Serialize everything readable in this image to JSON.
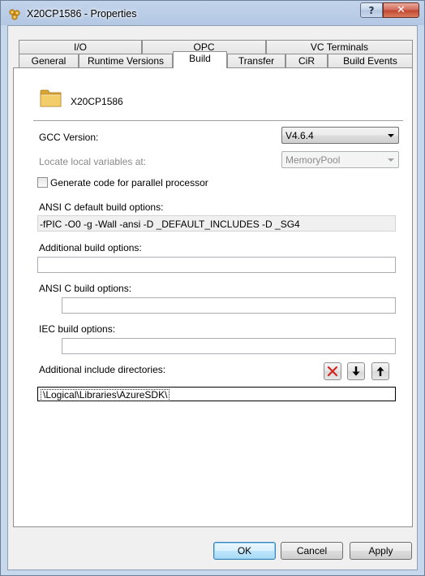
{
  "window": {
    "title": "X20CP1586 - Properties",
    "help_label": "?",
    "close_label": "✕"
  },
  "tabs": {
    "row_top": [
      {
        "id": "io",
        "label": "I/O"
      },
      {
        "id": "opc",
        "label": "OPC"
      },
      {
        "id": "vc-terminals",
        "label": "VC Terminals"
      }
    ],
    "row_bottom": [
      {
        "id": "general",
        "label": "General"
      },
      {
        "id": "runtime-versions",
        "label": "Runtime Versions"
      },
      {
        "id": "build",
        "label": "Build",
        "active": true
      },
      {
        "id": "transfer",
        "label": "Transfer"
      },
      {
        "id": "cir",
        "label": "CiR"
      },
      {
        "id": "build-events",
        "label": "Build Events"
      }
    ]
  },
  "header": {
    "object_name": "X20CP1586",
    "icon": "folder-icon"
  },
  "build": {
    "gcc_version_label": "GCC Version:",
    "gcc_version_value": "V4.6.4",
    "locate_vars_label": "Locate local variables at:",
    "locate_vars_value": "MemoryPool",
    "parallel_label": "Generate code for parallel processor",
    "parallel_checked": false,
    "ansi_default_label": "ANSI C default build options:",
    "ansi_default_value": "-fPIC -O0 -g -Wall -ansi -D _DEFAULT_INCLUDES -D _SG4",
    "additional_label": "Additional build options:",
    "additional_value": "",
    "ansi_label": "ANSI C build options:",
    "ansi_value": "",
    "iec_label": "IEC build options:",
    "iec_value": "",
    "include_dirs_label": "Additional include directories:",
    "include_dirs": [
      "\\Logical\\Libraries\\AzureSDK\\"
    ],
    "include_buttons": [
      "delete-icon",
      "move-down-icon",
      "move-up-icon"
    ]
  },
  "buttons": {
    "ok": "OK",
    "cancel": "Cancel",
    "apply": "Apply"
  },
  "colors": {
    "close": "#c0442f",
    "delete_x": "#d0271f",
    "title_bg": "#b4c8e4"
  }
}
